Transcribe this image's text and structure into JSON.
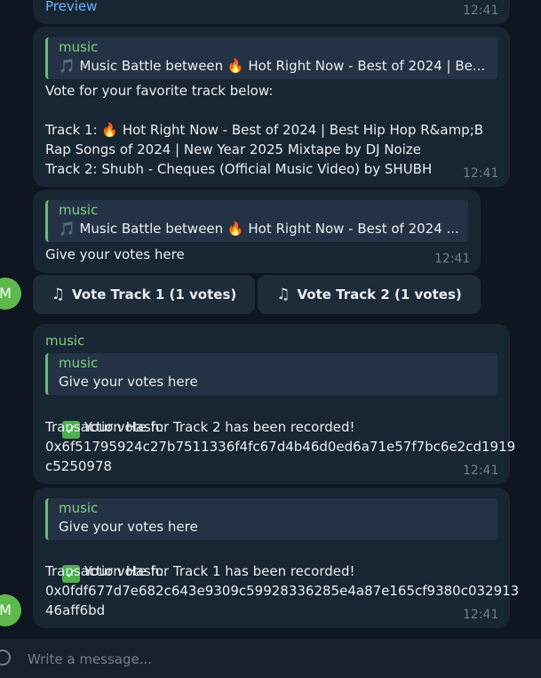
{
  "preview": {
    "link": "Preview",
    "time": "12:41"
  },
  "messages": [
    {
      "quote_name": "music",
      "quote_text": "🎵 Music Battle between 🔥 Hot Right Now - Best of 2024 | Be...",
      "text": "Vote for your favorite track below:\n\nTrack 1: 🔥 Hot Right Now - Best of 2024 | Best Hip Hop R&amp;B\nRap Songs of 2024 | New Year 2025 Mixtape by DJ Noize\nTrack 2: Shubh - Cheques (Official Music Video) by SHUBH",
      "time": "12:41"
    },
    {
      "quote_name": "music",
      "quote_text": "🎵 Music Battle between 🔥 Hot Right Now - Best of 2024 ...",
      "text": "Give your votes here",
      "time": "12:41"
    },
    {
      "sender": "music",
      "quote_name": "music",
      "quote_text": "Give your votes here",
      "text1": "Your vote for Track 2 has been recorded!",
      "text2": "Transaction Hash:\n0x6f51795924c27b7511336f4fc67d4b46d0ed6a71e57f7bc6e2cd1919\nc5250978",
      "time": "12:41"
    },
    {
      "quote_name": "music",
      "quote_text": "Give your votes here",
      "text1": "Your vote for Track 1 has been recorded!",
      "text2": "Transaction Hash:\n0x0fdf677d7e682c643e9309c59928336285e4a87e165cf9380c032913\n46aff6bd",
      "time": "12:41"
    }
  ],
  "buttons": [
    {
      "label": "Vote Track 1 (1 votes)",
      "icon": "music-note-icon"
    },
    {
      "label": "Vote Track 2 (1 votes)",
      "icon": "music-note-icon"
    }
  ],
  "avatar": {
    "initial": "M",
    "color": "#5fb84f"
  },
  "composer": {
    "placeholder": "Write a message..."
  },
  "colors": {
    "background": "#0e1621",
    "bubble": "#182533",
    "accent_green": "#7bd07a",
    "time": "#6d7f8f"
  }
}
